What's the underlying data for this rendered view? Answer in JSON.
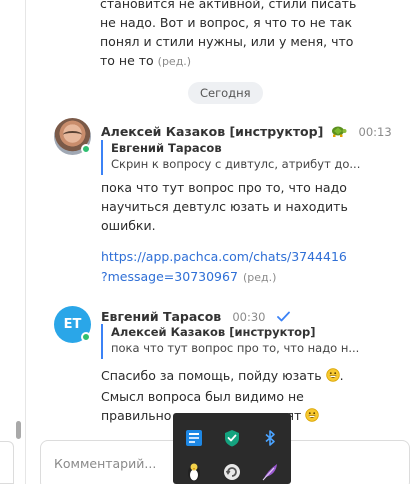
{
  "top_message": {
    "line0": "становится не активной, стили писать",
    "line1": "не надо.  Вот и вопрос, я что то не так",
    "line2": "понял и стили нужны, или у меня, что",
    "line3": "то не то",
    "edited": "(ред.)"
  },
  "date_separator": "Сегодня",
  "messages": [
    {
      "author": "Алексей Казаков [инструктор]",
      "badge_icon": "turtle-icon",
      "time": "00:13",
      "quote": {
        "author": "Евгений Тарасов",
        "text": "Скрин к вопросу с дивтулс, атрибут до..."
      },
      "text_line1": "пока что тут вопрос про то, что надо",
      "text_line2": "научиться девтулс юзать и находить",
      "text_line3": "ошибки.",
      "link_line1": "https://app.pachca.com/chats/3744416",
      "link_line2": "?message=30730967",
      "edited": "(ред.)"
    },
    {
      "author": "Евгений Тарасов",
      "avatar_initials": "ET",
      "time": "00:30",
      "status_icon": "check-icon",
      "quote": {
        "author": "Алексей Казаков [инструктор]",
        "text": "пока что тут вопрос про то, что надо н..."
      },
      "text_line1": "Спасибо за помощь, пойду юзать",
      "text_line2": "Смысл вопроса был видимо не",
      "text_line3": "правильно донесен или понят",
      "emoji_icon": "grinning-face-icon"
    }
  ],
  "composer": {
    "placeholder": "Комментарий..."
  },
  "tray_icons": [
    "app-icon",
    "shield-check-icon",
    "bluetooth-icon",
    "penguin-icon",
    "refresh-icon",
    "feather-icon"
  ],
  "colors": {
    "accent": "#2f6fd6",
    "quote_bar": "#3b82f6",
    "online": "#2fbf71",
    "avatar_bg": "#2aa6e8",
    "tray_bg": "#2b2b2b"
  }
}
